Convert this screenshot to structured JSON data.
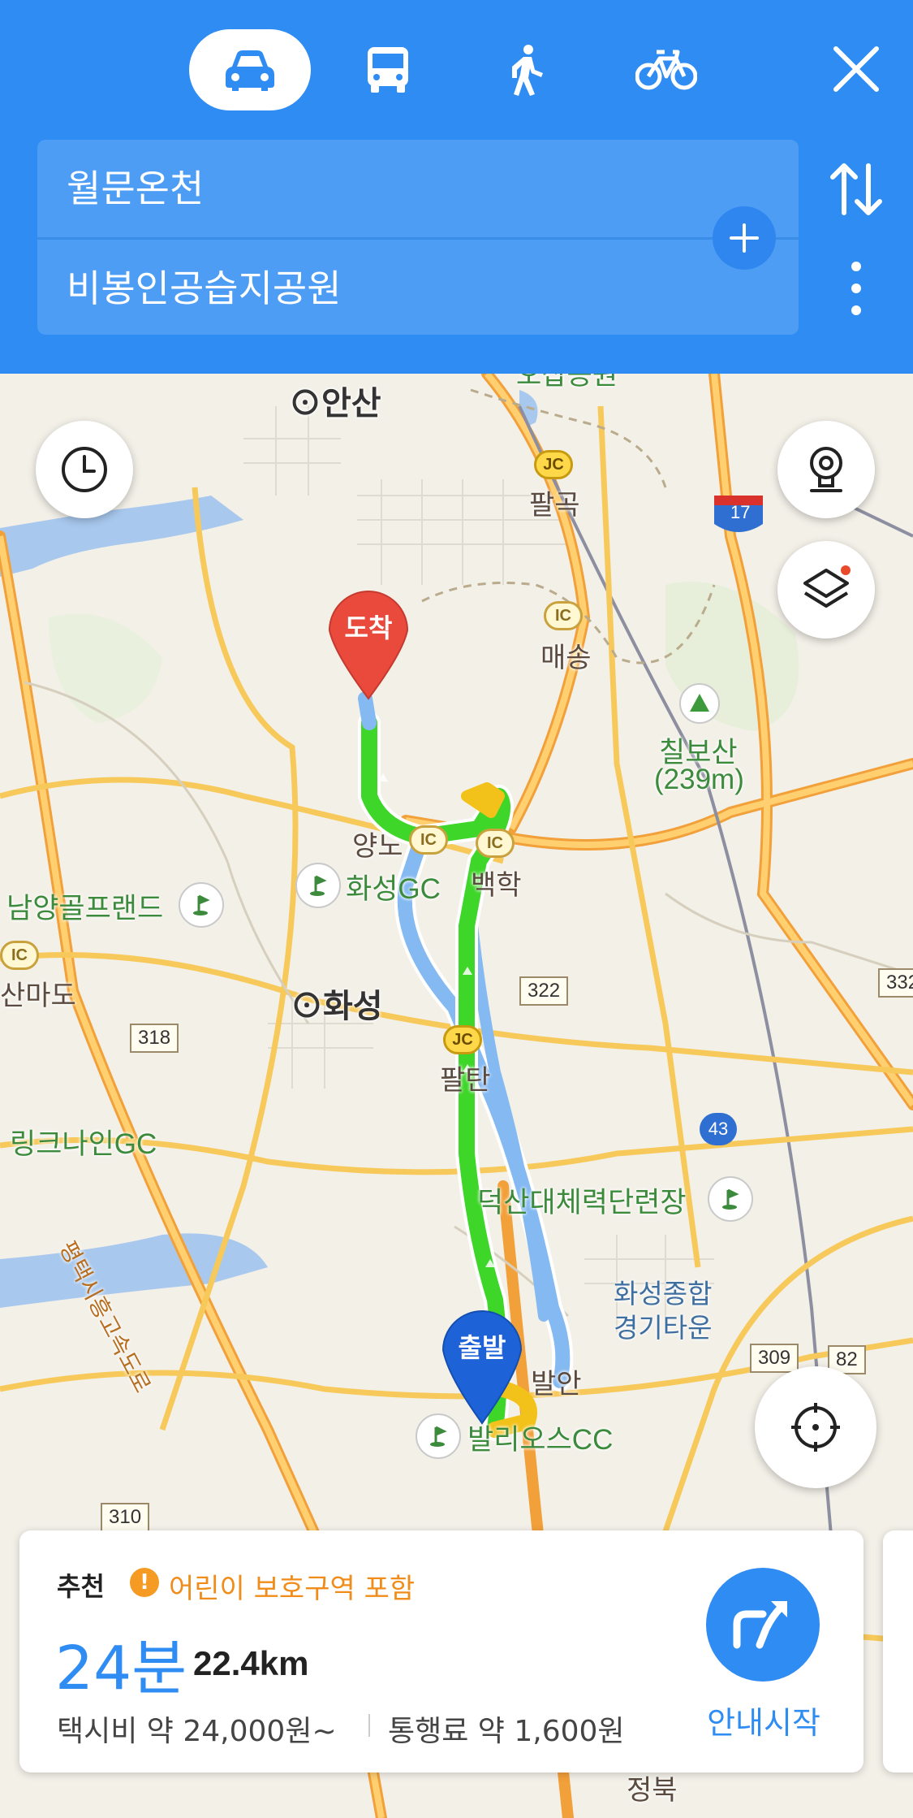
{
  "header": {
    "modes": [
      {
        "name": "car",
        "selected": true
      },
      {
        "name": "bus",
        "selected": false
      },
      {
        "name": "walk",
        "selected": false
      },
      {
        "name": "bike",
        "selected": false
      }
    ],
    "origin": "월문온천",
    "destination": "비봉인공습지공원",
    "accent_color": "#2f8cf3"
  },
  "map": {
    "labels": {
      "ansan": "안산",
      "palgok": "팔곡",
      "maesong": "매송",
      "chilbosan": "칠보산",
      "chilbosan_height": "(239m)",
      "yangno": "양노",
      "baekhak": "백학",
      "hwaseong_gc": "화성GC",
      "namyang_golf": "남양골프랜드",
      "sanmado": "산마도",
      "hwaseong": "화성",
      "paltan": "팔탄",
      "linknine_gc": "링크나인GC",
      "expressway": "평택시흥고속도로",
      "deoksan": "덕산대체력단련장",
      "hwaseong_complex": "화성종합",
      "gyeonggi_town": "경기타운",
      "baran": "발안",
      "barios_cc": "발리오스CC",
      "jeongbuk": "정북",
      "top_partial": "오삽공원"
    },
    "badges": {
      "jc": "JC",
      "ic": "IC"
    },
    "road_numbers": {
      "r17": "17",
      "r322": "322",
      "r318": "318",
      "r43": "43",
      "r309": "309",
      "r82": "82",
      "r310": "310",
      "r332": "332"
    },
    "pins": {
      "arrival": "도착",
      "departure": "출발"
    },
    "route_colors": {
      "main": "#3fd62a",
      "slow": "#f2c21b",
      "alt": "#84b9f2",
      "arrival_pin": "#ea4a3c",
      "departure_pin": "#1d62d6"
    }
  },
  "route_card": {
    "recommend_label": "추천",
    "warning_text": "어린이 보호구역 포함",
    "duration": "24분",
    "distance": "22.4km",
    "taxi_fare": "택시비 약 24,000원~",
    "toll_fee": "통행료 약 1,600원",
    "start_nav_label": "안내시작"
  }
}
